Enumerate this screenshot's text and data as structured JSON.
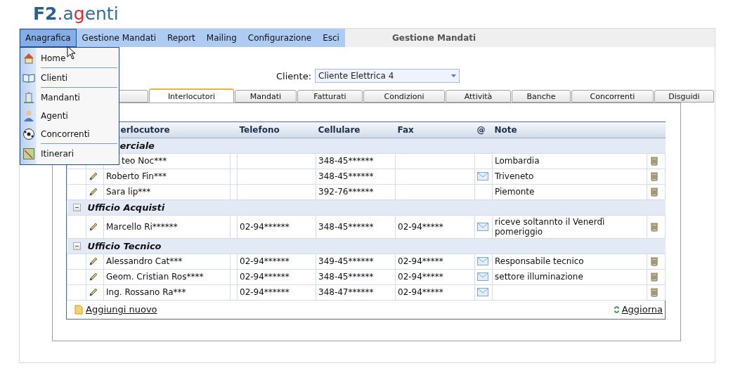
{
  "logo": [
    {
      "text": "F2",
      "color": "#2f5e8e",
      "bold": true
    },
    {
      "text": ".",
      "color": "#e8242a",
      "bold": false
    },
    {
      "text": "a",
      "color": "#3a6b9a",
      "bold": false
    },
    {
      "text": "g",
      "color": "#e8242a",
      "bold": false
    },
    {
      "text": "enti",
      "color": "#3a6b9a",
      "bold": false
    }
  ],
  "menu_bar": {
    "items": [
      {
        "label": "Anagrafica",
        "selected": true
      },
      {
        "label": "Gestione Mandati",
        "selected": false
      },
      {
        "label": "Report",
        "selected": false
      },
      {
        "label": "Mailing",
        "selected": false
      },
      {
        "label": "Configurazione",
        "selected": false
      },
      {
        "label": "Esci",
        "selected": false
      }
    ],
    "title": "Gestione Mandati"
  },
  "dropdown": {
    "items": [
      {
        "label": "Home",
        "divider_after": true
      },
      {
        "label": "Clienti",
        "divider_after": true
      },
      {
        "label": "Mandanti",
        "divider_after": false
      },
      {
        "label": "Agenti",
        "divider_after": false
      },
      {
        "label": "Concorrenti",
        "divider_after": true
      },
      {
        "label": "Itinerari",
        "divider_after": false
      }
    ]
  },
  "client_filter": {
    "label": "Cliente:",
    "value": "Cliente Elettrica 4"
  },
  "tabs": [
    {
      "selected": false
    },
    {
      "label": "Interlocutori",
      "selected": true
    },
    {
      "label": "Mandati",
      "selected": false
    },
    {
      "label": "Fatturati",
      "selected": false
    },
    {
      "label": "Condizioni",
      "selected": false
    },
    {
      "label": "Attività",
      "selected": false
    },
    {
      "label": "Banche",
      "selected": false
    },
    {
      "label": "Concorrenti",
      "selected": false
    },
    {
      "label": "Disguidi",
      "selected": false
    }
  ],
  "table": {
    "columns": [
      "erlocutore",
      "Telefono",
      "Cellulare",
      "Fax",
      "@",
      "Note"
    ],
    "groups": [
      {
        "title": "erciale",
        "rows": [
          {
            "name": "teo Noc***",
            "telefono": "",
            "cellulare": "348-45******",
            "fax": "",
            "email": false,
            "note": "Lombardia"
          },
          {
            "name": "Roberto Fin***",
            "telefono": "",
            "cellulare": "348-45******",
            "fax": "",
            "email": true,
            "note": "Triveneto"
          },
          {
            "name": "Sara lip***",
            "telefono": "",
            "cellulare": "392-76******",
            "fax": "",
            "email": false,
            "note": "Piemonte"
          }
        ]
      },
      {
        "title": "Ufficio Acquisti",
        "expanded": true,
        "rows": [
          {
            "name": "Marcello Ri******",
            "telefono": "02-94******",
            "cellulare": "348-45******",
            "fax": "02-94*****",
            "email": true,
            "note": "riceve soltannto il Venerdì pomeriggio"
          }
        ]
      },
      {
        "title": "Ufficio Tecnico",
        "expanded": true,
        "rows": [
          {
            "name": "Alessandro Cat***",
            "telefono": "02-94******",
            "cellulare": "349-45******",
            "fax": "02-94*****",
            "email": true,
            "note": "Responsabile tecnico"
          },
          {
            "name": "Geom. Cristian Ros****",
            "telefono": "02-94******",
            "cellulare": "348-45******",
            "fax": "02-94*****",
            "email": true,
            "note": "settore illuminazione"
          },
          {
            "name": "Ing. Rossano Ra***",
            "telefono": "02-94******",
            "cellulare": "348-47******",
            "fax": "02-94*****",
            "email": true,
            "note": ""
          }
        ]
      }
    ],
    "add_link": "Aggiungi nuovo",
    "refresh_link": "Aggiorna"
  }
}
